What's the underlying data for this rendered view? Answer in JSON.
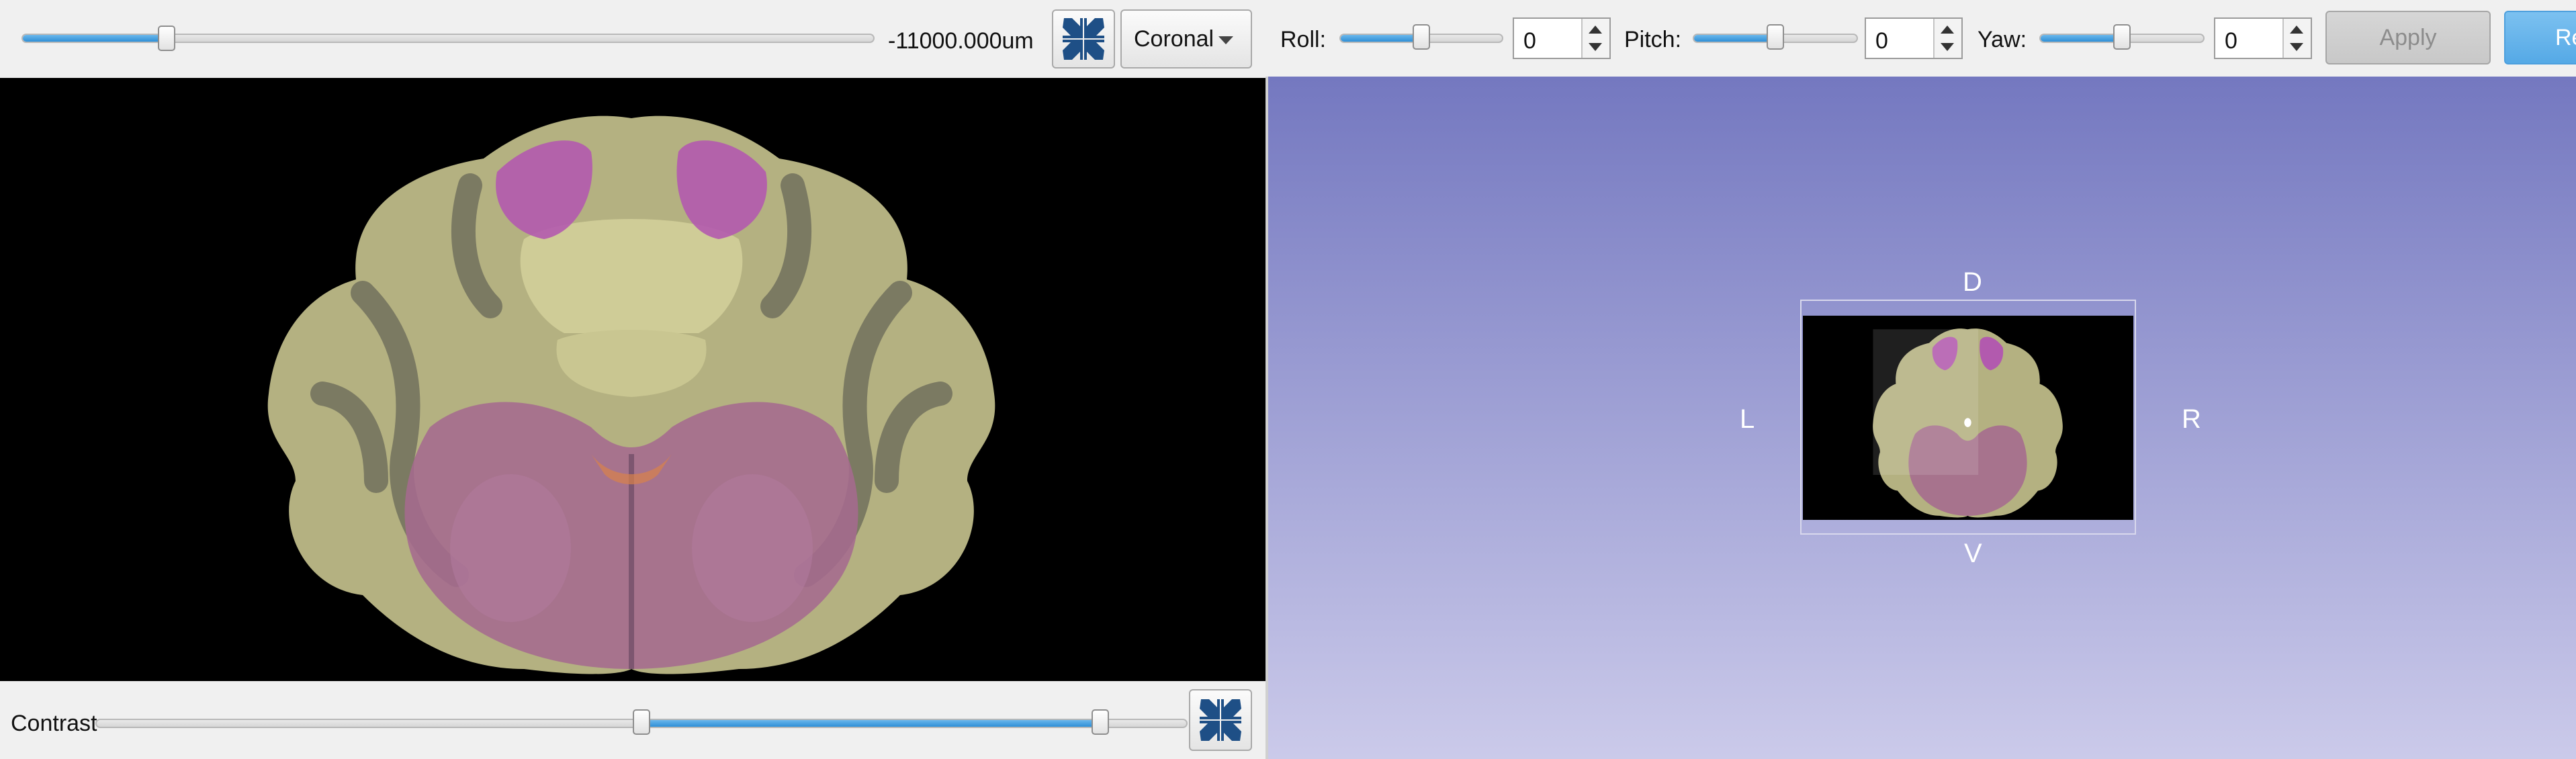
{
  "slice": {
    "offset_text": "-11000.000um",
    "slider_value": 0.17
  },
  "orientation": {
    "selected": "Coronal"
  },
  "rotation": {
    "roll_label": "Roll:",
    "roll_value": "0",
    "roll_slider": 0.5,
    "pitch_label": "Pitch:",
    "pitch_value": "0",
    "pitch_slider": 0.5,
    "yaw_label": "Yaw:",
    "yaw_value": "0",
    "yaw_slider": 0.5
  },
  "buttons": {
    "apply_label": "Apply",
    "reset_label": "Re"
  },
  "contrast": {
    "label": "Contrast",
    "low": 0.5,
    "high": 0.92
  },
  "view3d": {
    "dorsal": "D",
    "ventral": "V",
    "left": "L",
    "right": "R"
  },
  "colors": {
    "accent": "#3a95db",
    "slice_bg": "#000000",
    "view3d_top": "#7479c0",
    "view3d_bottom": "#c9c8ea",
    "cerebellum": "#c6c38f",
    "brainstem": "#a86a8f",
    "highlight": "#b458b0"
  },
  "icons": {
    "collapse": "collapse-arrows-icon",
    "dropdown": "chevron-down-icon"
  }
}
